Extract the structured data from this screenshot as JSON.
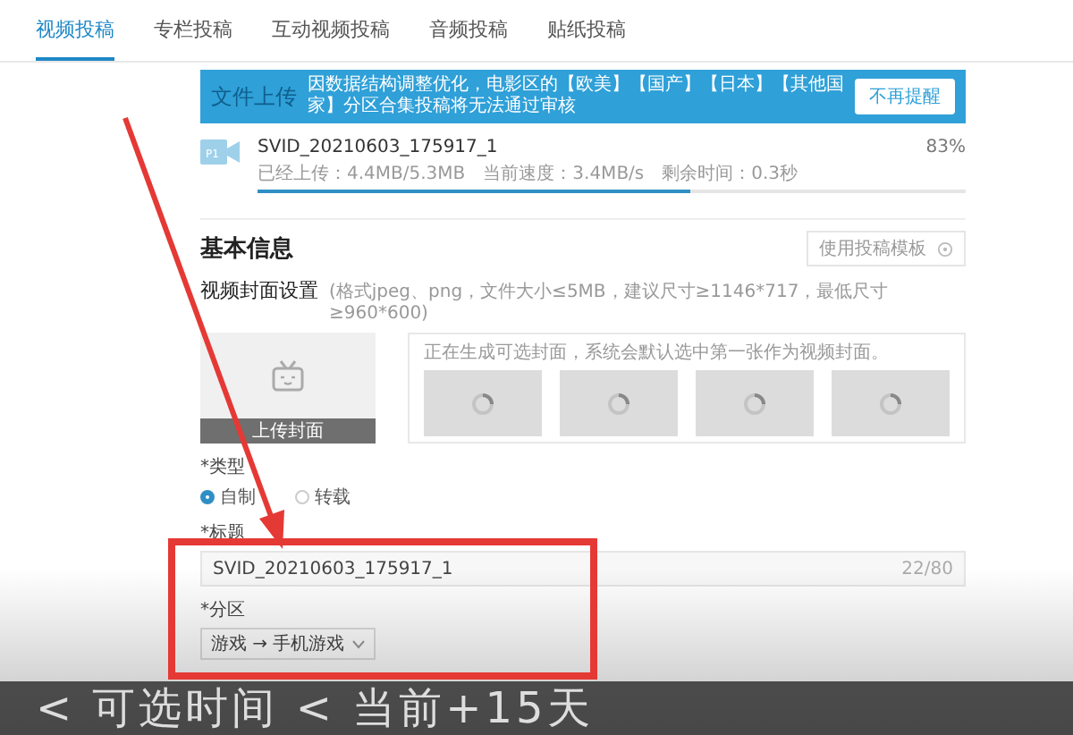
{
  "tabs": [
    {
      "label": "视频投稿",
      "selected": true
    },
    {
      "label": "专栏投稿",
      "selected": false
    },
    {
      "label": "互动视频投稿",
      "selected": false
    },
    {
      "label": "音频投稿",
      "selected": false
    },
    {
      "label": "贴纸投稿",
      "selected": false
    }
  ],
  "notice": {
    "heading": "文件上传",
    "text": "因数据结构调整优化，电影区的【欧美】【国产】【日本】【其他国家】分区合集投稿将无法通过审核",
    "button": "不再提醒"
  },
  "upload": {
    "filename": "SVID_20210603_175917_1",
    "percent": "83%",
    "uploaded": "已经上传：4.4MB/5.3MB",
    "speed": "当前速度：3.4MB/s",
    "remaining": "剩余时间：0.3秒",
    "level": 0.61,
    "icon_label": "P1"
  },
  "basic_info": {
    "title": "基本信息",
    "template_button": "使用投稿模板"
  },
  "cover": {
    "label": "视频封面设置",
    "hint": "(格式jpeg、png，文件大小≤5MB，建议尺寸≥1146*717，最低尺寸≥960*600)",
    "upload_button": "上传封面",
    "generating_hint": "正在生成可选封面，系统会默认选中第一张作为视频封面。",
    "thumbnails": [
      {
        "kind": "loading"
      },
      {
        "kind": "loading"
      },
      {
        "kind": "loading"
      },
      {
        "kind": "loading"
      }
    ]
  },
  "type": {
    "label": "*类型",
    "options": [
      {
        "label": "自制",
        "selected": true
      },
      {
        "label": "转载",
        "selected": false
      }
    ]
  },
  "title_field": {
    "label": "*标题",
    "value": "SVID_20210603_175917_1",
    "counter": "22/80"
  },
  "category": {
    "label": "*分区",
    "value": "游戏 → 手机游戏"
  },
  "subtitle": "< 可选时间 < 当前+15天"
}
